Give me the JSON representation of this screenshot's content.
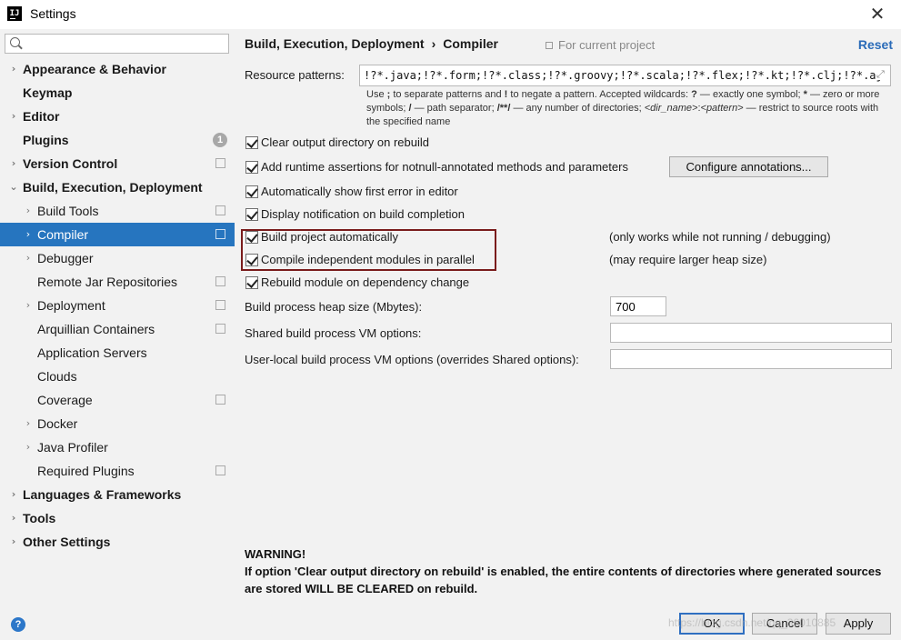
{
  "window": {
    "title": "Settings",
    "close_glyph": "✕",
    "app_icon": "IJ"
  },
  "search": {
    "placeholder": "",
    "value": ""
  },
  "tree": [
    {
      "label": "Appearance & Behavior",
      "bold": true,
      "arrow": "›",
      "level": 0,
      "name": "appearance-behavior"
    },
    {
      "label": "Keymap",
      "bold": true,
      "arrow": "",
      "level": 0,
      "name": "keymap"
    },
    {
      "label": "Editor",
      "bold": true,
      "arrow": "›",
      "level": 0,
      "name": "editor"
    },
    {
      "label": "Plugins",
      "bold": true,
      "arrow": "",
      "level": 0,
      "badge": "1",
      "name": "plugins"
    },
    {
      "label": "Version Control",
      "bold": true,
      "arrow": "›",
      "level": 0,
      "proj": true,
      "name": "version-control"
    },
    {
      "label": "Build, Execution, Deployment",
      "bold": true,
      "arrow": "⌄",
      "level": 0,
      "name": "build-execution-deployment"
    },
    {
      "label": "Build Tools",
      "bold": false,
      "arrow": "›",
      "level": 1,
      "proj": true,
      "name": "build-tools"
    },
    {
      "label": "Compiler",
      "bold": false,
      "arrow": "›",
      "level": 1,
      "proj": true,
      "selected": true,
      "name": "compiler"
    },
    {
      "label": "Debugger",
      "bold": false,
      "arrow": "›",
      "level": 1,
      "name": "debugger"
    },
    {
      "label": "Remote Jar Repositories",
      "bold": false,
      "arrow": "",
      "level": 1,
      "proj": true,
      "name": "remote-jar-repositories"
    },
    {
      "label": "Deployment",
      "bold": false,
      "arrow": "›",
      "level": 1,
      "proj": true,
      "name": "deployment"
    },
    {
      "label": "Arquillian Containers",
      "bold": false,
      "arrow": "",
      "level": 1,
      "proj": true,
      "name": "arquillian-containers"
    },
    {
      "label": "Application Servers",
      "bold": false,
      "arrow": "",
      "level": 1,
      "name": "application-servers"
    },
    {
      "label": "Clouds",
      "bold": false,
      "arrow": "",
      "level": 1,
      "name": "clouds"
    },
    {
      "label": "Coverage",
      "bold": false,
      "arrow": "",
      "level": 1,
      "proj": true,
      "name": "coverage"
    },
    {
      "label": "Docker",
      "bold": false,
      "arrow": "›",
      "level": 1,
      "name": "docker"
    },
    {
      "label": "Java Profiler",
      "bold": false,
      "arrow": "›",
      "level": 1,
      "name": "java-profiler"
    },
    {
      "label": "Required Plugins",
      "bold": false,
      "arrow": "",
      "level": 1,
      "proj": true,
      "name": "required-plugins"
    },
    {
      "label": "Languages & Frameworks",
      "bold": true,
      "arrow": "›",
      "level": 0,
      "name": "languages-frameworks"
    },
    {
      "label": "Tools",
      "bold": true,
      "arrow": "›",
      "level": 0,
      "name": "tools"
    },
    {
      "label": "Other Settings",
      "bold": true,
      "arrow": "›",
      "level": 0,
      "name": "other-settings"
    }
  ],
  "header": {
    "crumb_parent": "Build, Execution, Deployment",
    "crumb_sep": "›",
    "crumb_current": "Compiler",
    "scope": "For current project",
    "reset": "Reset"
  },
  "resource": {
    "label": "Resource patterns:",
    "value": "!?*.java;!?*.form;!?*.class;!?*.groovy;!?*.scala;!?*.flex;!?*.kt;!?*.clj;!?*.aj",
    "expand_glyph": "⤢",
    "hint_1": "Use ",
    "hint_semicolon": ";",
    "hint_2": " to separate patterns and ",
    "hint_bang": "!",
    "hint_3": " to negate a pattern. Accepted wildcards: ",
    "hint_q": "?",
    "hint_4": " — exactly one symbol; ",
    "hint_star": "*",
    "hint_5": " — zero or more symbols; ",
    "hint_slash": "/",
    "hint_6": " — path separator; ",
    "hint_dstar": "/**/",
    "hint_7": " — any number of directories; ",
    "hint_dir": "<dir_name>",
    "hint_colon": ":",
    "hint_pattern": "<pattern>",
    "hint_8": " — restrict to source roots with the specified name"
  },
  "options": [
    {
      "label": "Clear output directory on rebuild",
      "checked": true,
      "name": "clear-output-checkbox"
    },
    {
      "label": "Add runtime assertions for notnull-annotated methods and parameters",
      "checked": true,
      "name": "runtime-assertions-checkbox"
    },
    {
      "label": "Automatically show first error in editor",
      "checked": true,
      "name": "show-first-error-checkbox"
    },
    {
      "label": "Display notification on build completion",
      "checked": true,
      "name": "build-notification-checkbox"
    },
    {
      "label": "Build project automatically",
      "checked": true,
      "name": "build-automatically-checkbox"
    },
    {
      "label": "Compile independent modules in parallel",
      "checked": true,
      "name": "compile-parallel-checkbox"
    },
    {
      "label": "Rebuild module on dependency change",
      "checked": true,
      "name": "rebuild-on-dependency-checkbox"
    }
  ],
  "configure_button": "Configure annotations...",
  "notes": {
    "build_auto": "(only works while not running / debugging)",
    "parallel": "(may require larger heap size)"
  },
  "fields": {
    "heap_label": "Build process heap size (Mbytes):",
    "heap_value": "700",
    "shared_label": "Shared build process VM options:",
    "shared_value": "",
    "user_label": "User-local build process VM options (overrides Shared options):",
    "user_value": ""
  },
  "warning": {
    "title": "WARNING!",
    "body": "If option 'Clear output directory on rebuild' is enabled, the entire contents of directories where generated sources are stored WILL BE CLEARED on rebuild."
  },
  "footer": {
    "help": "?",
    "ok": "OK",
    "cancel": "Cancel",
    "apply": "Apply",
    "watermark": "https://blog.csdn.net/qq_36010885"
  },
  "colors": {
    "selection": "#2675bf",
    "link": "#2a6bb8",
    "highlight_border": "#7a1c1c",
    "default_button_border": "#2f6fc1"
  }
}
